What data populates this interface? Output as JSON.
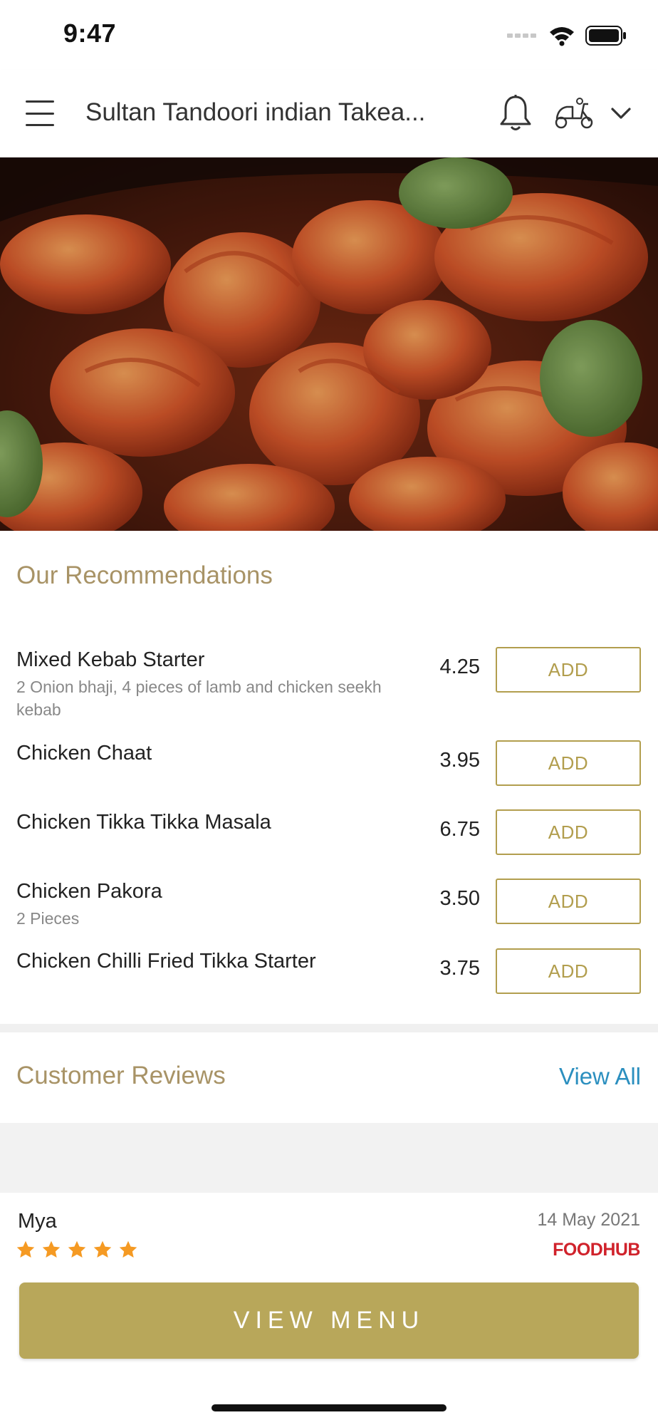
{
  "status_bar": {
    "time": "9:47"
  },
  "header": {
    "title": "Sultan Tandoori indian Takea...",
    "menu_icon": "hamburger-menu-icon",
    "bell_icon": "bell-icon",
    "delivery_icon": "scooter-icon",
    "dropdown_icon": "chevron-down-icon"
  },
  "hero": {
    "image": "grilled-prawns-photo"
  },
  "recommendations": {
    "title": "Our Recommendations",
    "items": [
      {
        "name": "Mixed Kebab Starter",
        "description": "2 Onion bhaji, 4 pieces of lamb and chicken seekh kebab",
        "price": "4.25",
        "button": "ADD"
      },
      {
        "name": "Chicken Chaat",
        "description": "",
        "price": "3.95",
        "button": "ADD"
      },
      {
        "name": "Chicken Tikka Tikka Masala",
        "description": "",
        "price": "6.75",
        "button": "ADD"
      },
      {
        "name": "Chicken Pakora",
        "description": "2 Pieces",
        "price": "3.50",
        "button": "ADD"
      },
      {
        "name": "Chicken Chilli Fried Tikka Starter",
        "description": "",
        "price": "3.75",
        "button": "ADD"
      }
    ]
  },
  "reviews": {
    "title": "Customer Reviews",
    "view_all": "View All",
    "items": [
      {
        "name": "Mya",
        "date": "14 May 2021",
        "rating": 5,
        "source": "FOODHUB"
      }
    ]
  },
  "footer": {
    "view_menu": "VIEW MENU"
  },
  "colors": {
    "accent": "#b29e4e",
    "button_fill": "#b8a75a",
    "link": "#2b8fbf",
    "section_title": "#a89366",
    "star": "#f59a23",
    "brand": "#d0222b"
  }
}
